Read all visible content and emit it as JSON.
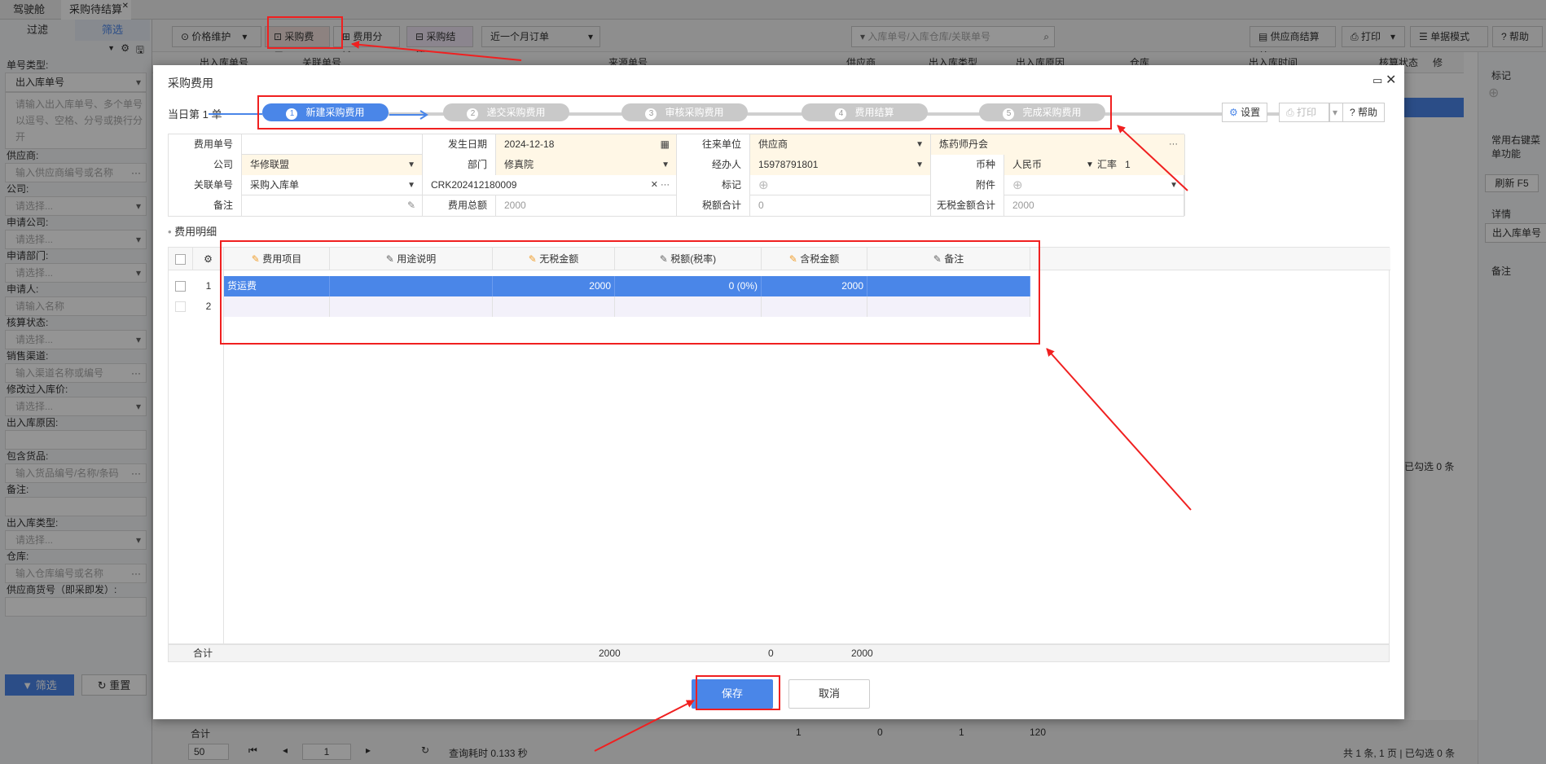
{
  "tabs": [
    {
      "label": "驾驶舱"
    },
    {
      "label": "采购待结算"
    }
  ],
  "left": {
    "tab_filter": "过滤",
    "tab_screen": "筛选",
    "fields": [
      {
        "label": "单号类型:",
        "value": "出入库单号",
        "placeholder": ""
      },
      {
        "label": "",
        "value": "",
        "placeholder": "请输入出入库单号、多个单号以逗号、空格、分号或换行分开"
      },
      {
        "label": "供应商:",
        "placeholder": "输入供应商编号或名称"
      },
      {
        "label": "公司:",
        "placeholder": "请选择..."
      },
      {
        "label": "申请公司:",
        "placeholder": "请选择..."
      },
      {
        "label": "申请部门:",
        "placeholder": "请选择..."
      },
      {
        "label": "申请人:",
        "placeholder": "请输入名称"
      },
      {
        "label": "核算状态:",
        "placeholder": "请选择..."
      },
      {
        "label": "销售渠道:",
        "placeholder": "输入渠道名称或编号"
      },
      {
        "label": "修改过入库价:",
        "placeholder": "请选择..."
      },
      {
        "label": "出入库原因:",
        "placeholder": ""
      },
      {
        "label": "包含货品:",
        "placeholder": "输入货品编号/名称/条码"
      },
      {
        "label": "备注:",
        "placeholder": ""
      },
      {
        "label": "出入库类型:",
        "placeholder": "请选择..."
      },
      {
        "label": "仓库:",
        "placeholder": "输入仓库编号或名称"
      },
      {
        "label": "供应商货号（即采即发）:",
        "placeholder": ""
      }
    ],
    "btn_filter": "筛选",
    "btn_reset": "重置"
  },
  "toolbar": {
    "price_maint": "价格维护",
    "purchase_fee": "采购费用",
    "fee_allocate": "费用分摊",
    "purchase_settle": "采购结算",
    "date_range": "近一个月订单",
    "search_placeholder": "入库单号/入库仓库/关联单号",
    "supplier_settle": "供应商结算单",
    "print": "打印",
    "doc_mode": "单据模式",
    "help": "帮助"
  },
  "bg_headers": [
    "出入库单号",
    "关联单号",
    "来源单号",
    "供应商",
    "出入库类型",
    "出入库原因",
    "仓库",
    "出入库时间",
    "核算状态",
    "修"
  ],
  "right": {
    "mark": "标记",
    "common_ops": "常用右键菜单功能",
    "refresh": "刷新 F5",
    "detail": "详情",
    "detail_field": "出入库单号",
    "remark": "备注"
  },
  "bottom": {
    "total_label": "合计",
    "tot1": "1",
    "tot2": "0",
    "tot3": "1",
    "tot4": "120",
    "page_size": "50",
    "page": "1",
    "query_time": "查询耗时 0.133 秒",
    "page_info": "共 1 条, 1 页 | 已勾选 0 条",
    "selected_info": "已勾选 0 条"
  },
  "modal": {
    "title": "采购费用",
    "today": "当日第 1 单",
    "steps": [
      {
        "num": "1",
        "label": "新建采购费用"
      },
      {
        "num": "2",
        "label": "递交采购费用"
      },
      {
        "num": "3",
        "label": "审核采购费用"
      },
      {
        "num": "4",
        "label": "费用结算"
      },
      {
        "num": "5",
        "label": "完成采购费用"
      }
    ],
    "btn_settings": "设置",
    "btn_print": "打印",
    "btn_help": "帮助",
    "form": {
      "fee_no_label": "费用单号",
      "fee_no": "",
      "date_label": "发生日期",
      "date": "2024-12-18",
      "partner_label": "往来单位",
      "partner_type": "供应商",
      "partner_name": "炼药师丹会",
      "company_label": "公司",
      "company": "华修联盟",
      "dept_label": "部门",
      "dept": "修真院",
      "handler_label": "经办人",
      "handler": "15978791801",
      "currency_label": "币种",
      "currency": "人民币",
      "rate_label": "汇率",
      "rate": "1",
      "related_label": "关联单号",
      "related_type": "采购入库单",
      "related_no": "CRK202412180009",
      "mark_label": "标记",
      "attach_label": "附件",
      "remark_label": "备注",
      "remark": "",
      "fee_total_label": "费用总额",
      "fee_total": "2000",
      "tax_total_label": "税额合计",
      "tax_total": "0",
      "notax_total_label": "无税金额合计",
      "notax_total": "2000"
    },
    "section": "费用明细",
    "grid_headers": [
      "费用项目",
      "用途说明",
      "无税金额",
      "税额(税率)",
      "含税金额",
      "备注"
    ],
    "rows": [
      {
        "no": "1",
        "item": "货运费",
        "desc": "",
        "notax": "2000",
        "tax": "0 (0%)",
        "withtax": "2000",
        "remark": ""
      },
      {
        "no": "2",
        "item": "",
        "desc": "",
        "notax": "",
        "tax": "",
        "withtax": "",
        "remark": ""
      }
    ],
    "sum_label": "合计",
    "sum_notax": "2000",
    "sum_tax": "0",
    "sum_withtax": "2000",
    "btn_save": "保存",
    "btn_cancel": "取消"
  },
  "colors": {
    "primary": "#4a86e8",
    "highlight_red": "#f02020",
    "step_gray": "#c9c9c9",
    "required_bg": "#fff7e6"
  }
}
